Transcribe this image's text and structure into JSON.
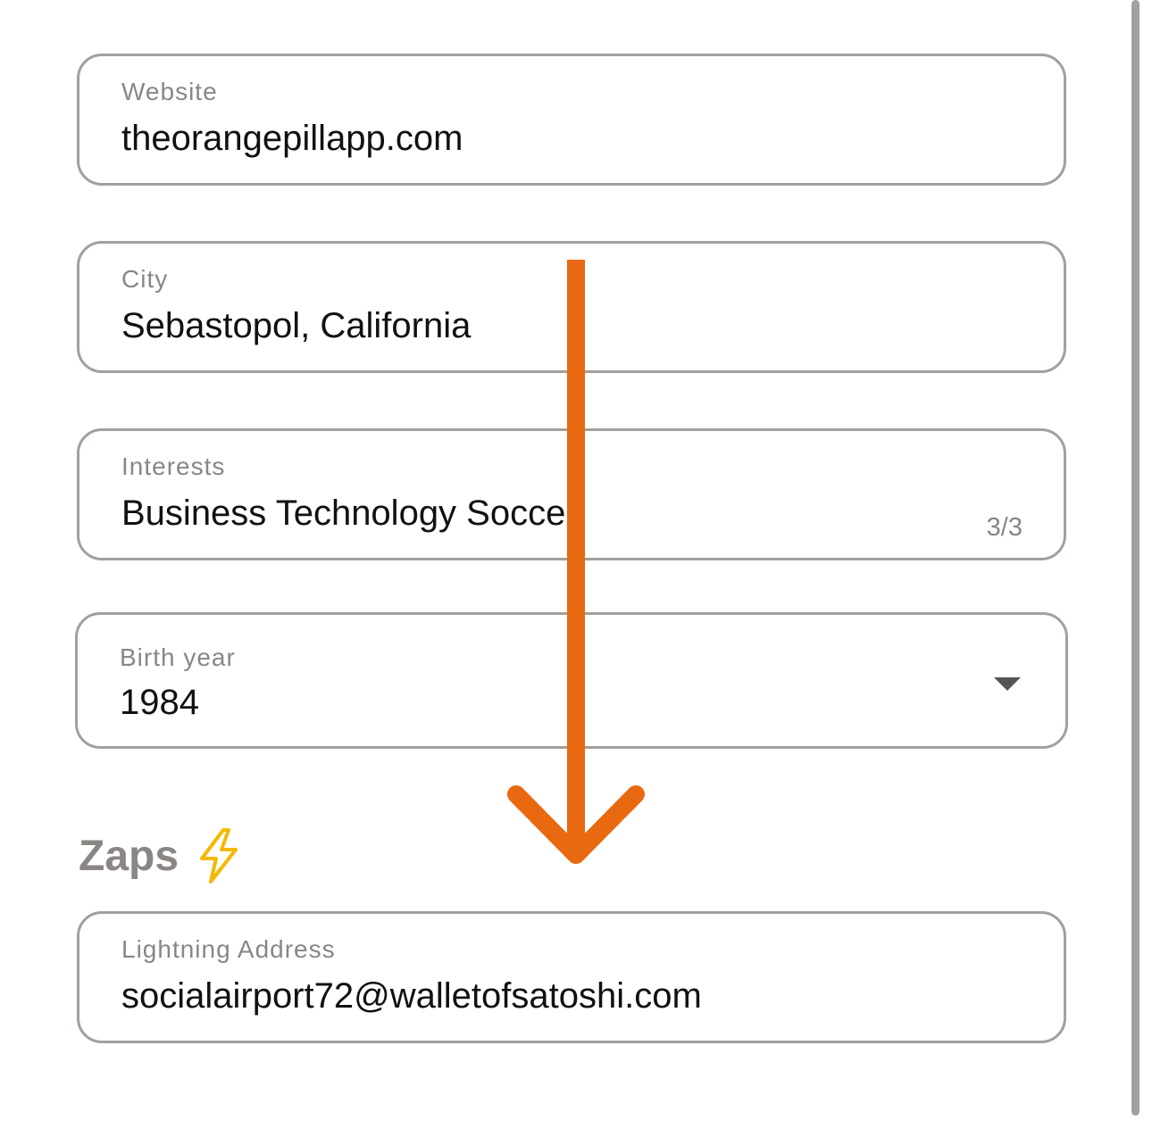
{
  "form": {
    "website": {
      "label": "Website",
      "value": "theorangepillapp.com"
    },
    "city": {
      "label": "City",
      "value": "Sebastopol, California"
    },
    "interests": {
      "label": "Interests",
      "value": "Business Technology Soccer",
      "counter": "3/3"
    },
    "birth_year": {
      "label": "Birth year",
      "value": "1984"
    }
  },
  "zaps": {
    "title": "Zaps",
    "lightning_address": {
      "label": "Lightning Address",
      "value": "socialairport72@walletofsatoshi.com"
    }
  },
  "colors": {
    "arrow": "#e8690f",
    "border": "#a39f9d",
    "label": "#8a8684",
    "bolt": "#f5b800"
  },
  "icons": {
    "bolt": "lightning-bolt-icon",
    "dropdown": "caret-down-icon",
    "overlay": "down-arrow-icon"
  }
}
